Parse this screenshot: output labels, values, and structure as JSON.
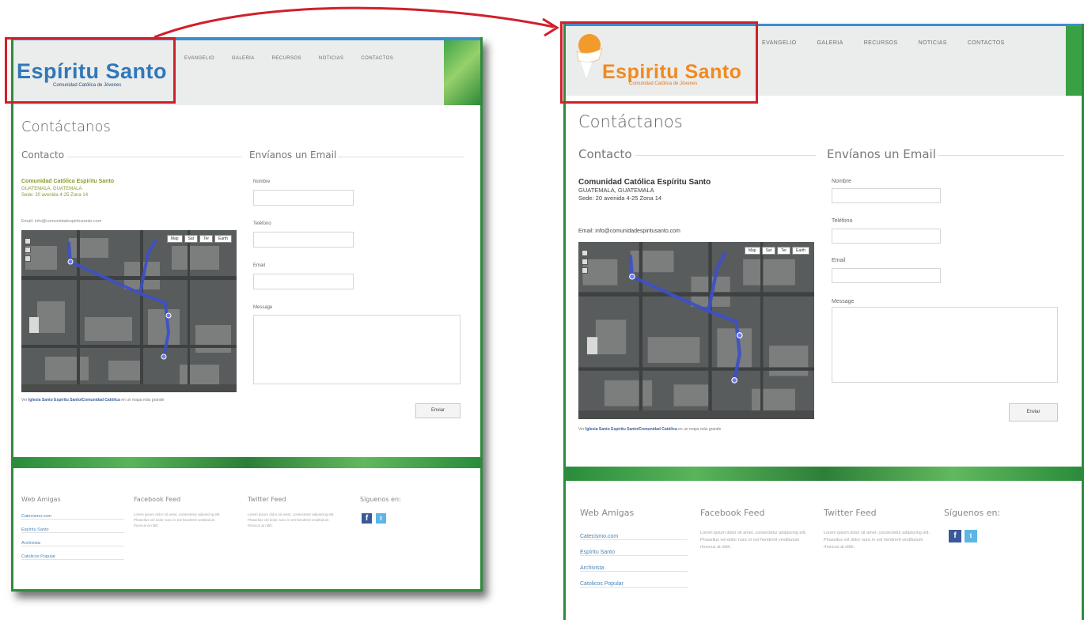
{
  "left": {
    "logo": {
      "title": "Espíritu Santo",
      "subtitle": "Comunidad Católica de Jóvenes"
    },
    "nav": [
      "EVANGELIO",
      "GALERIA",
      "RECURSOS",
      "NOTICIAS",
      "CONTACTOS"
    ],
    "page_title": "Contáctanos",
    "contact_title": "Contacto",
    "email_section_title": "Envíanos un Email",
    "org_name": "Comunidad Católica Espíritu Santo",
    "addr_line1": "GUATEMALA, GUATEMALA",
    "addr_line2": "Sede: 20 avenida 4-25 Zona 14",
    "email_line": "Email: info@comunidadespiritusanto.com",
    "map_buttons": [
      "Map",
      "Sat",
      "Ter",
      "Earth"
    ],
    "map_caption_prefix": "Ver",
    "map_caption_link": "Iglesia Santo Espíritu Santo/Comunidad Católica",
    "map_caption_suffix": "en un mapa más grande",
    "form": {
      "name": "Nombre",
      "phone": "Teléfono",
      "email": "Email",
      "message": "Message",
      "send": "Enviar"
    },
    "footer": {
      "web_amigas_title": "Web Amigas",
      "web_amigas_links": [
        "Catecismo.com",
        "Espíritu Santo",
        "Archivista",
        "Catolicos Popular"
      ],
      "facebook_title": "Facebook Feed",
      "facebook_text": "Lorem ipsum dolor sit amet, consectetur adipiscing elit. Phasellus vel dolor nunc in est hendrerit vestibulum rhoncus at nibh.",
      "twitter_title": "Twitter Feed",
      "twitter_text": "Lorem ipsum dolor sit amet, consectetur adipiscing elit. Phasellus vel dolor nunc in est hendrerit vestibulum rhoncus at nibh.",
      "follow_title": "Síguenos en:"
    }
  },
  "right": {
    "logo": {
      "title": "Espiritu Santo",
      "subtitle": "Comunidad Católica de Jóvenes"
    },
    "nav": [
      "EVANGELIO",
      "GALERIA",
      "RECURSOS",
      "NOTICIAS",
      "CONTACTOS"
    ],
    "page_title": "Contáctanos",
    "contact_title": "Contacto",
    "email_section_title": "Envíanos un Email",
    "org_name": "Comunidad Católica Espíritu Santo",
    "addr_line1": "GUATEMALA, GUATEMALA",
    "addr_line2": "Sede: 20 avenida 4-25 Zona 14",
    "email_line": "Email: info@comunidadespiritusanto.com",
    "map_buttons": [
      "Map",
      "Sat",
      "Ter",
      "Earth"
    ],
    "map_caption_prefix": "Ver",
    "map_caption_link": "Iglesia Santo Espíritu Santo/Comunidad Católica",
    "map_caption_suffix": "en un mapa más grande",
    "form": {
      "name": "Nombre",
      "phone": "Teléfono",
      "email": "Email",
      "message": "Message",
      "send": "Enviar"
    },
    "footer": {
      "web_amigas_title": "Web Amigas",
      "web_amigas_links": [
        "Catecismo.com",
        "Espíritu Santo",
        "Archivista",
        "Catolicos Popular"
      ],
      "facebook_title": "Facebook Feed",
      "facebook_text": "Lorem ipsum dolor sit amet, consectetur adipiscing elit. Phasellus vel dolor nunc in est hendrerit vestibulum rhoncus at nibh.",
      "twitter_title": "Twitter Feed",
      "twitter_text": "Lorem ipsum dolor sit amet, consectetur adipiscing elit. Phasellus vel dolor nunc in est hendrerit vestibulum rhoncus at nibh.",
      "follow_title": "Síguenos en:"
    }
  },
  "colors": {
    "highlight": "#d0202a",
    "green": "#2e8b3d",
    "blue_bar": "#3c8ed0",
    "logo_blue": "#2f78b8",
    "logo_orange": "#f08a1e"
  },
  "icons": [
    "facebook-icon",
    "twitter-icon",
    "logo-emblem-icon",
    "arrow-icon"
  ]
}
